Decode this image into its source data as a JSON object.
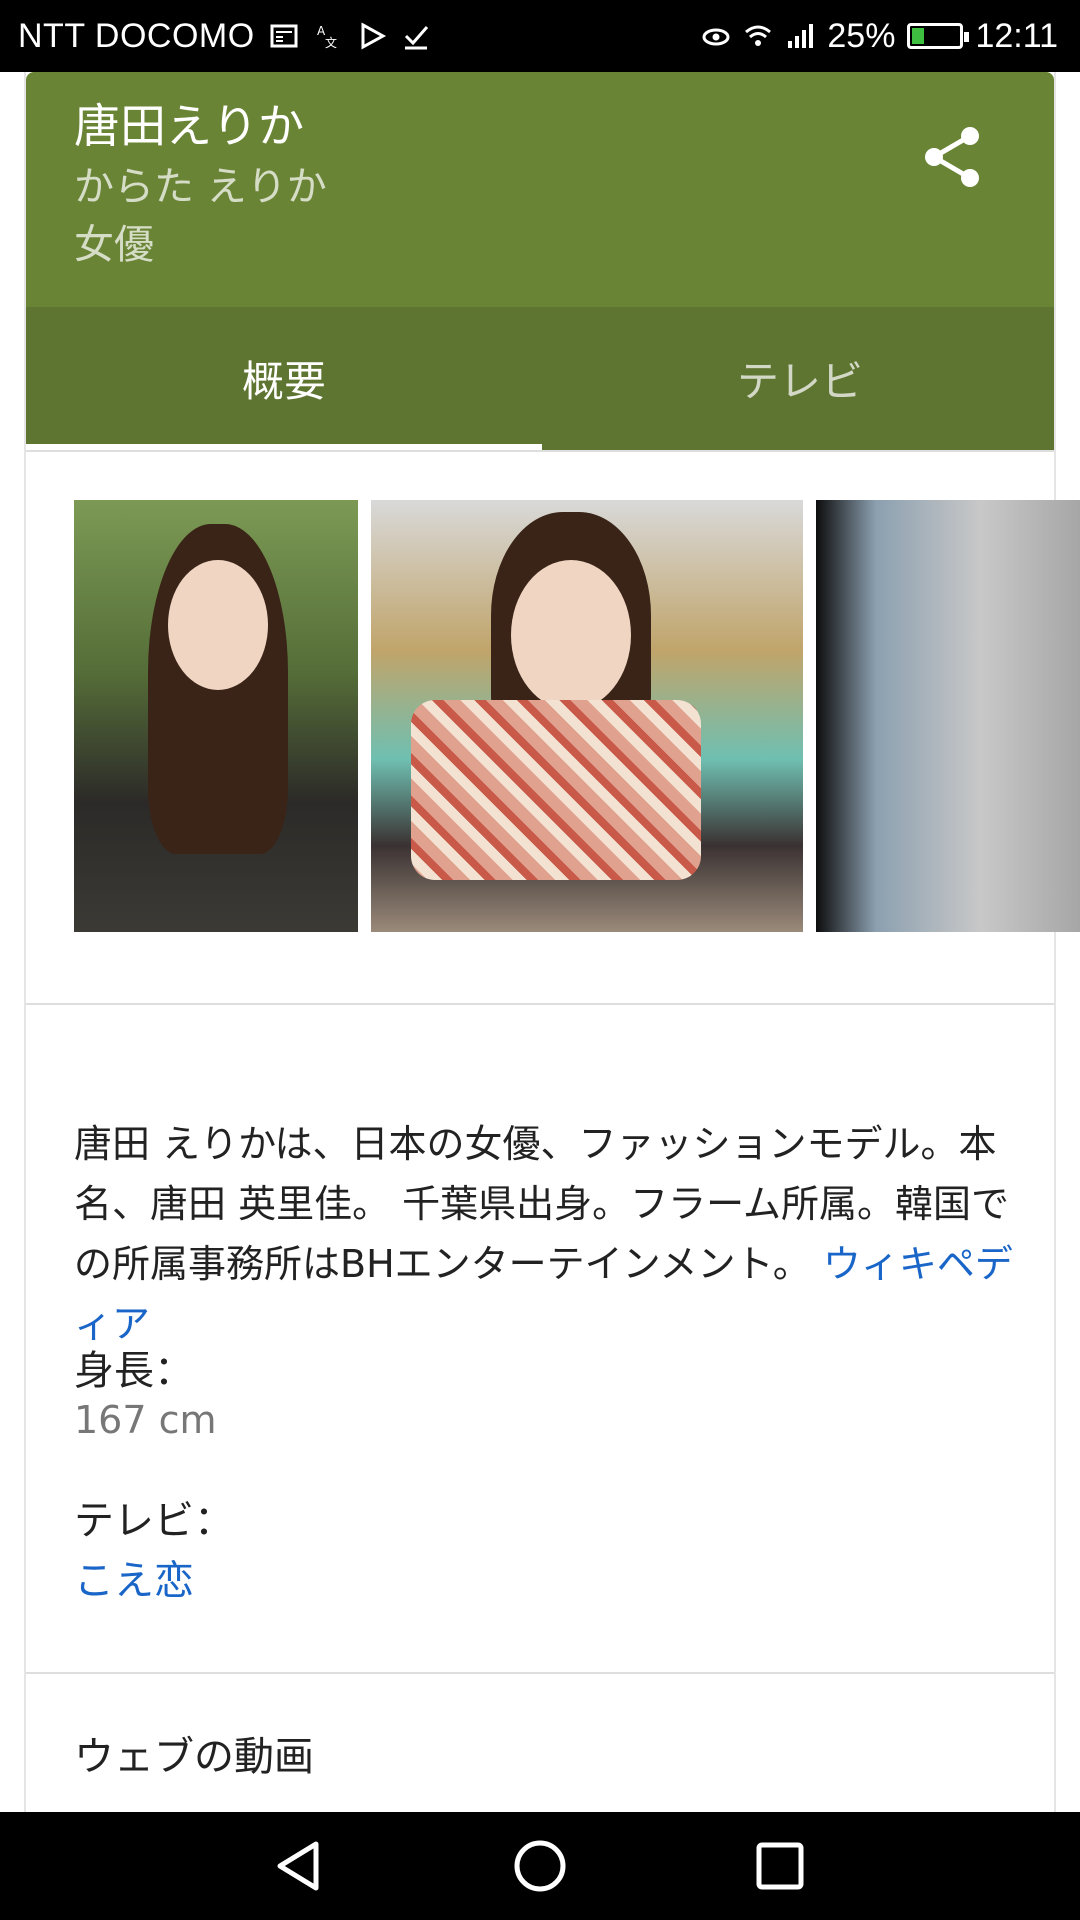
{
  "status_bar": {
    "carrier": "NTT DOCOMO",
    "left_icons": [
      "news-icon",
      "translate-icon",
      "play-store-icon",
      "check-icon"
    ],
    "right_icons": [
      "eye-comfort-icon",
      "wifi-icon",
      "signal-icon"
    ],
    "battery_percent_text": "25%",
    "battery_level": 0.25,
    "time": "12:11"
  },
  "knowledge_panel": {
    "name": "唐田えりか",
    "reading": "からた えりか",
    "occupation": "女優",
    "accent_color": "#6a8436",
    "tabs": [
      {
        "label": "概要",
        "active": true
      },
      {
        "label": "テレビ",
        "active": false
      }
    ],
    "images": [
      "portrait-photo-1",
      "portrait-photo-2",
      "portrait-photo-3"
    ],
    "description": "唐田 えりかは、日本の女優、ファッションモデル。本名、唐田 英里佳。 千葉県出身。フラーム所属。韓国での所属事務所はBHエンターテインメント。",
    "source_link": "ウィキペディア",
    "facts": {
      "height_label": "身長：",
      "height_value": "167 cm",
      "tv_label": "テレビ：",
      "tv_value": "こえ恋"
    },
    "web_videos_heading": "ウェブの動画"
  },
  "nav_bar": {
    "buttons": [
      "back-icon",
      "home-icon",
      "recents-icon"
    ]
  }
}
